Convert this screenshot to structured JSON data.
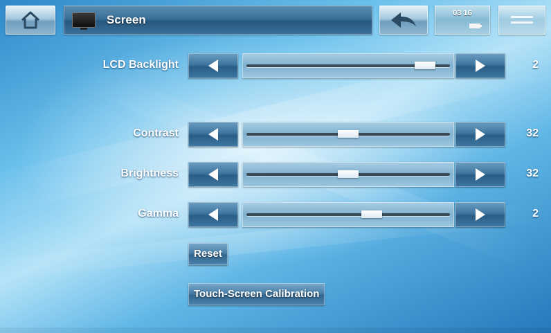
{
  "header": {
    "title": "Screen",
    "status_time": "03 16",
    "icons": {
      "home": "home-icon",
      "screen": "screen-icon",
      "back": "back-arrow-icon",
      "battery": "battery-icon",
      "menu": "menu-icon"
    }
  },
  "settings": [
    {
      "label": "LCD Backlight",
      "value": "2",
      "level": 0.92
    },
    {
      "label": "Contrast",
      "value": "32",
      "level": 0.5
    },
    {
      "label": "Brightness",
      "value": "32",
      "level": 0.5
    },
    {
      "label": "Gamma",
      "value": "2",
      "level": 0.63
    }
  ],
  "buttons": {
    "reset": "Reset",
    "calibration": "Touch-Screen Calibration"
  },
  "colors": {
    "accent": "#3e759f",
    "background": "#6cc1ec"
  }
}
